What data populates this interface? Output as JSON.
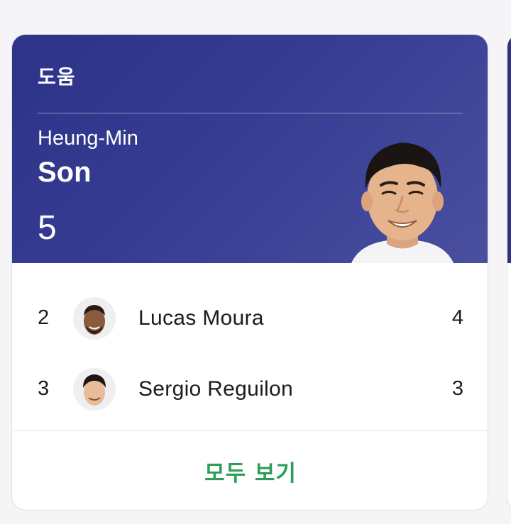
{
  "card": {
    "title": "도움",
    "leader": {
      "first_name": "Heung-Min",
      "last_name": "Son",
      "value": "5",
      "photo": "player-photo"
    },
    "rows": [
      {
        "rank": "2",
        "name": "Lucas Moura",
        "value": "4",
        "avatar": "player-avatar"
      },
      {
        "rank": "3",
        "name": "Sergio Reguilon",
        "value": "3",
        "avatar": "player-avatar"
      }
    ],
    "view_all_label": "모두 보기"
  },
  "colors": {
    "header_bg": "#2d3387",
    "header_bg_light": "#4a4f9f",
    "link_green": "#2e9e57",
    "text_dark": "#1c1c1e",
    "card_border": "#e0e0e4"
  }
}
